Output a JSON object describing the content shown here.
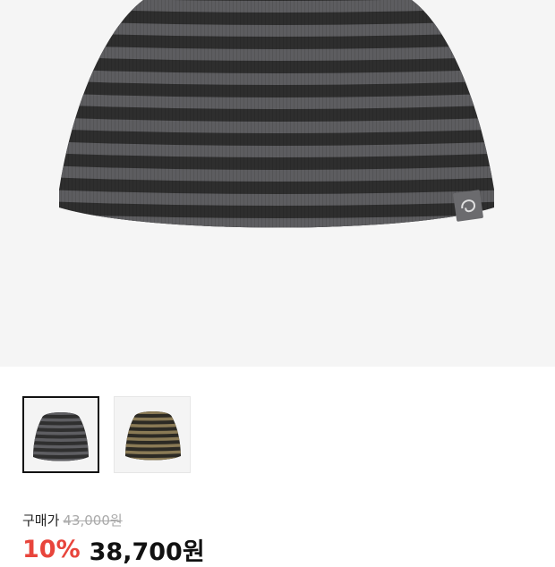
{
  "product": {
    "main_image": "striped-beanie-dark-gray",
    "thumbnails": [
      {
        "name": "beanie-gray-stripe",
        "selected": true
      },
      {
        "name": "beanie-khaki-stripe",
        "selected": false
      }
    ]
  },
  "price": {
    "label": "구매가",
    "original": "43,000원",
    "discount": "10%",
    "sale": "38,700원"
  },
  "colors": {
    "discount": "#e8453c",
    "stripe_dark": "#2e2e2e",
    "stripe_gray": "#5d5d60",
    "stripe_khaki": "#8a7a55"
  }
}
